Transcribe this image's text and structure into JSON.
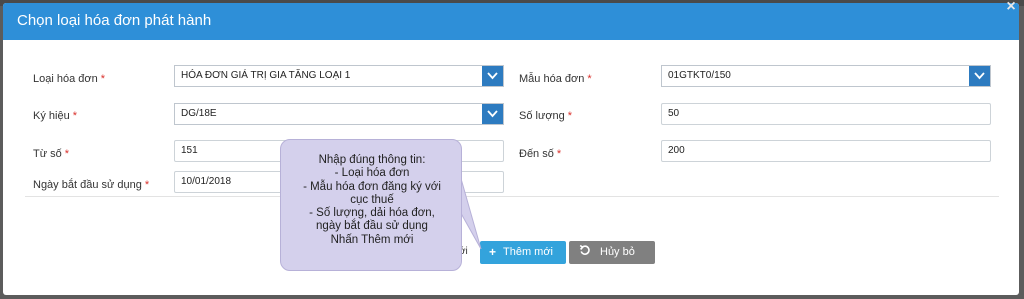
{
  "dialog": {
    "title": "Chọn loại hóa đơn phát hành",
    "close_symbol": "×"
  },
  "form": {
    "required_mark": "*",
    "invoice_type": {
      "label": "Loại hóa đơn",
      "value": "HÓA ĐƠN GIÁ TRỊ GIA TĂNG LOẠI 1"
    },
    "template": {
      "label": "Mẫu hóa đơn",
      "value": "01GTKT0/150"
    },
    "symbol": {
      "label": "Ký hiệu",
      "value": "DG/18E"
    },
    "quantity": {
      "label": "Số lượng",
      "value": "50"
    },
    "from_number": {
      "label": "Từ số",
      "value": "151"
    },
    "to_number": {
      "label": "Đến số",
      "value": "200"
    },
    "start_date": {
      "label": "Ngày bắt đầu sử dụng",
      "value": "10/01/2018"
    }
  },
  "buttons": {
    "partial_text": "ới",
    "add_label": "Thêm mới",
    "add_icon": "plus-icon",
    "cancel_label": "Hủy bỏ",
    "cancel_icon": "undo-icon"
  },
  "tooltip": {
    "lines": [
      "Nhập đúng thông tin:",
      "- Loại hóa đơn",
      "- Mẫu hóa đơn đăng ký với",
      "cục thuế",
      "- Số lượng, dải hóa đơn,",
      "ngày bắt đầu sử dụng",
      "Nhấn Thêm mới"
    ]
  },
  "colors": {
    "header": "#2e8fd8",
    "required": "#d9302b",
    "select_arrow": "#2d7bc0",
    "add_button": "#33a3dc",
    "cancel_button": "#808080",
    "tooltip_bg": "#d4d0ec"
  }
}
